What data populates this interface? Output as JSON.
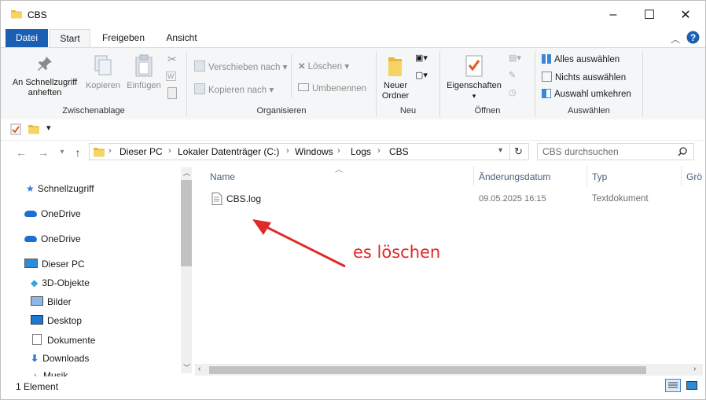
{
  "window": {
    "title": "CBS",
    "minimize_glyph": "–",
    "maximize_glyph": "☐",
    "close_glyph": "✕"
  },
  "tabs": [
    {
      "label": "Datei"
    },
    {
      "label": "Start"
    },
    {
      "label": "Freigeben"
    },
    {
      "label": "Ansicht"
    }
  ],
  "ribbon": {
    "clipboard": {
      "pin_line1": "An Schnellzugriff",
      "pin_line2": "anheften",
      "copy": "Kopieren",
      "paste": "Einfügen",
      "group": "Zwischenablage"
    },
    "organize": {
      "move_to": "Verschieben nach",
      "copy_to": "Kopieren nach",
      "delete": "Löschen",
      "rename": "Umbenennen",
      "group": "Organisieren"
    },
    "new": {
      "new_folder_line1": "Neuer",
      "new_folder_line2": "Ordner",
      "group": "Neu"
    },
    "open": {
      "properties": "Eigenschaften",
      "group": "Öffnen"
    },
    "select": {
      "select_all": "Alles auswählen",
      "select_none": "Nichts auswählen",
      "invert": "Auswahl umkehren",
      "group": "Auswählen"
    }
  },
  "address": {
    "crumbs": [
      "Dieser PC",
      "Lokaler Datenträger (C:)",
      "Windows",
      "Logs",
      "CBS"
    ],
    "search_placeholder": "CBS durchsuchen"
  },
  "nav": {
    "quick_access": "Schnellzugriff",
    "onedrive1": "OneDrive",
    "onedrive2": "OneDrive",
    "this_pc": "Dieser PC",
    "objects3d": "3D-Objekte",
    "pictures": "Bilder",
    "desktop": "Desktop",
    "documents": "Dokumente",
    "downloads": "Downloads",
    "music": "Musik"
  },
  "columns": {
    "name": "Name",
    "date": "Änderungsdatum",
    "type": "Typ",
    "size": "Grö"
  },
  "files": [
    {
      "name": "CBS.log",
      "date": "09.05.2025 16:15",
      "type": "Textdokument"
    }
  ],
  "status": {
    "count": "1 Element"
  },
  "annotation": {
    "text": "es löschen",
    "color": "#e02a2a"
  },
  "colors": {
    "accent": "#1a5fb4",
    "folder": "#f2c94c"
  }
}
